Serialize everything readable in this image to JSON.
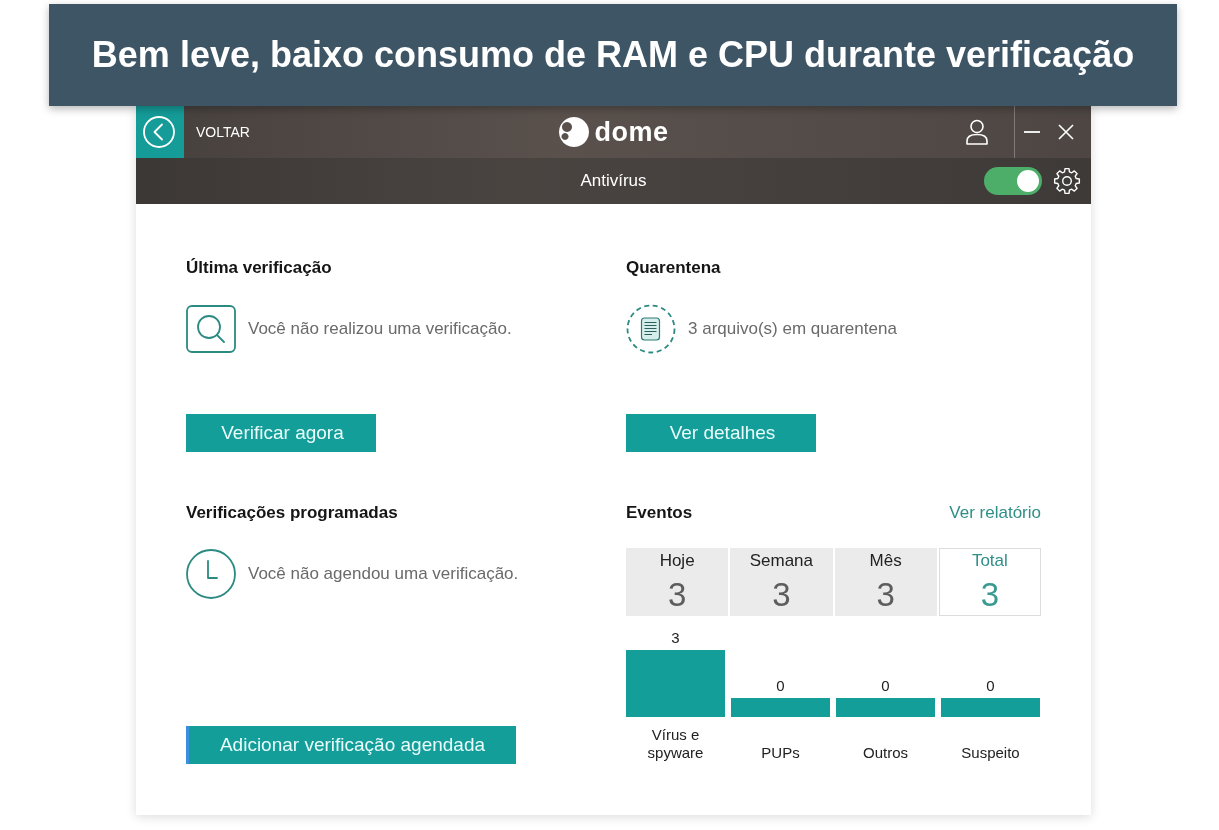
{
  "banner": {
    "text": "Bem leve, baixo consumo de RAM e CPU durante verificação"
  },
  "title_bar": {
    "back_label": "VOLTAR",
    "logo": "dome"
  },
  "sub_bar": {
    "title": "Antivírus",
    "toggle_on": true
  },
  "last_scan": {
    "title": "Última verificação",
    "message": "Você não realizou uma verificação.",
    "button": {
      "label": "Verificar agora",
      "focused": false
    }
  },
  "quarantine": {
    "title": "Quarentena",
    "message": "3 arquivo(s) em quarentena",
    "button": {
      "label": "Ver detalhes",
      "focused": false
    }
  },
  "scheduled": {
    "title": "Verificações programadas",
    "message": "Você não agendou uma verificação.",
    "button": {
      "label": "Adicionar verificação agendada",
      "focused": true
    }
  },
  "events": {
    "title": "Eventos",
    "link": "Ver relatório",
    "periods": [
      {
        "label": "Hoje",
        "count": "3",
        "selected": false
      },
      {
        "label": "Semana",
        "count": "3",
        "selected": false
      },
      {
        "label": "Mês",
        "count": "3",
        "selected": false
      },
      {
        "label": "Total",
        "count": "3",
        "selected": true
      }
    ],
    "chart_data": {
      "type": "bar",
      "categories": [
        "Vírus e spyware",
        "PUPs",
        "Outros",
        "Suspeito"
      ],
      "values": [
        3,
        0,
        0,
        0
      ],
      "data_labels": true
    }
  }
}
